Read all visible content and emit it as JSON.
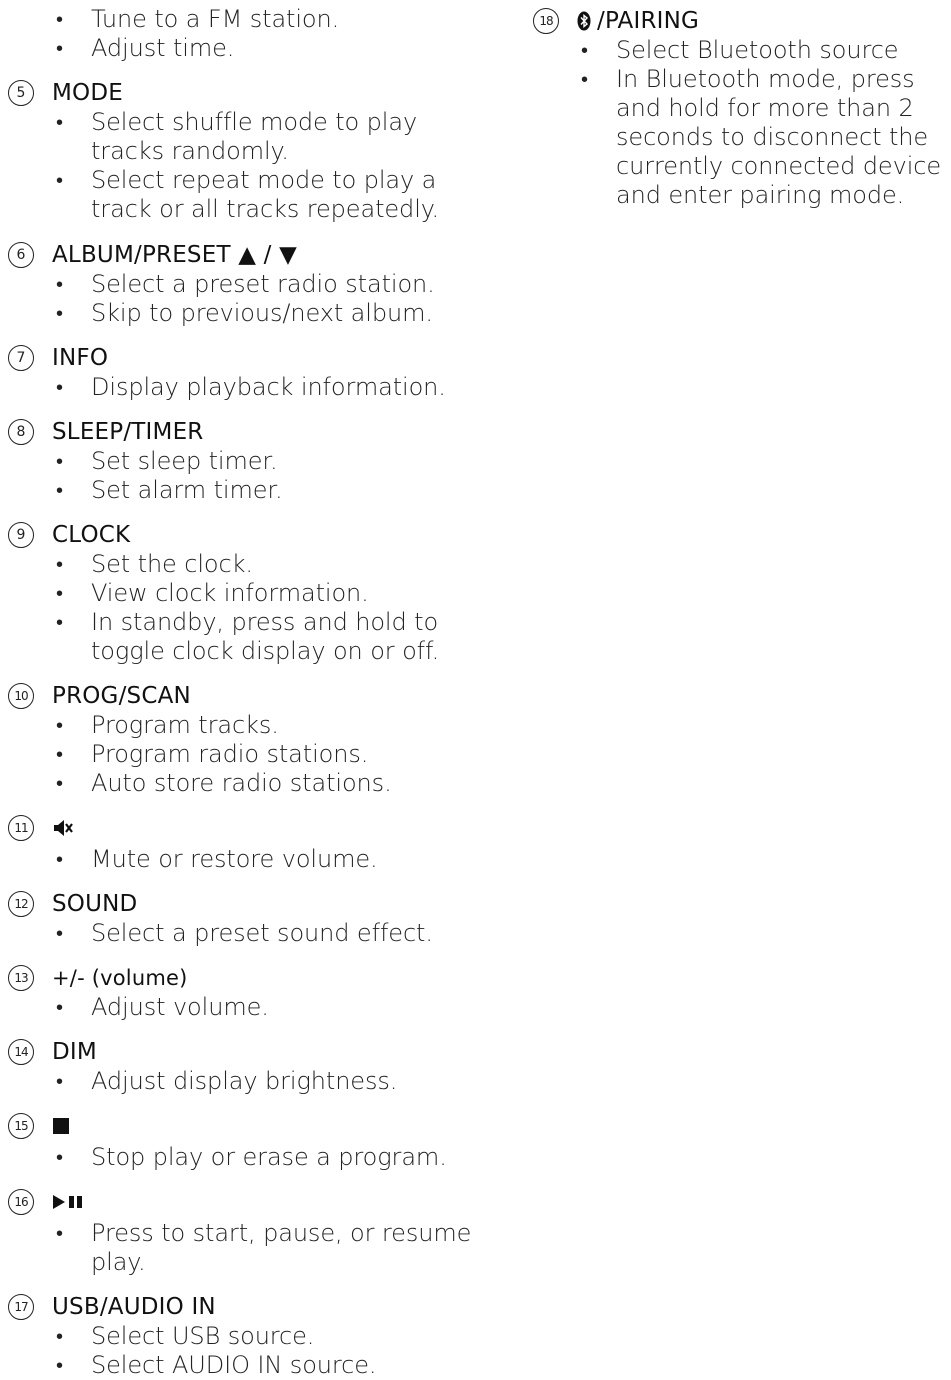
{
  "top_bullets": [
    "Tune to a FM station.",
    "Adjust time."
  ],
  "sections_left": [
    {
      "number": "5",
      "title": "MODE",
      "bullets": [
        "Select shuffle mode to play tracks randomly.",
        "Select repeat mode to play a track or all tracks repeatedly."
      ]
    },
    {
      "number": "6",
      "title": "ALBUM/PRESET ▲ / ▼",
      "bullets": [
        "Select a preset radio station.",
        "Skip to previous/next album."
      ]
    },
    {
      "number": "7",
      "title": "INFO",
      "bullets": [
        "Display playback information."
      ]
    },
    {
      "number": "8",
      "title": "SLEEP/TIMER",
      "bullets": [
        "Set sleep timer.",
        "Set alarm timer."
      ]
    },
    {
      "number": "9",
      "title": "CLOCK",
      "bullets": [
        "Set the clock.",
        "View clock information.",
        "In standby, press and hold to toggle clock display on or off."
      ]
    },
    {
      "number": "10",
      "title": "PROG/SCAN",
      "bullets": [
        "Program tracks.",
        "Program radio stations.",
        "Auto store radio stations."
      ]
    },
    {
      "number": "11",
      "icon": "mute-icon",
      "bullets": [
        "Mute or restore volume."
      ]
    },
    {
      "number": "12",
      "title": "SOUND",
      "bullets": [
        "Select a preset sound effect."
      ]
    },
    {
      "number": "13",
      "title": "+/- (volume)",
      "bullets": [
        "Adjust volume."
      ]
    },
    {
      "number": "14",
      "title": "DIM",
      "bullets": [
        "Adjust display brightness."
      ]
    },
    {
      "number": "15",
      "icon": "stop-icon",
      "bullets": [
        "Stop play or erase a program."
      ]
    },
    {
      "number": "16",
      "icon": "play-pause-icon",
      "bullets": [
        "Press to start, pause, or resume play."
      ]
    },
    {
      "number": "17",
      "title": "USB/AUDIO IN",
      "bullets": [
        "Select USB source.",
        "Select AUDIO IN source."
      ]
    }
  ],
  "sections_right": [
    {
      "number": "18",
      "icon": "bluetooth-icon",
      "title": "/PAIRING",
      "bullets": [
        "Select Bluetooth source",
        "In Bluetooth mode, press and hold for more than 2 seconds to disconnect the currently connected device and enter pairing mode."
      ]
    }
  ]
}
